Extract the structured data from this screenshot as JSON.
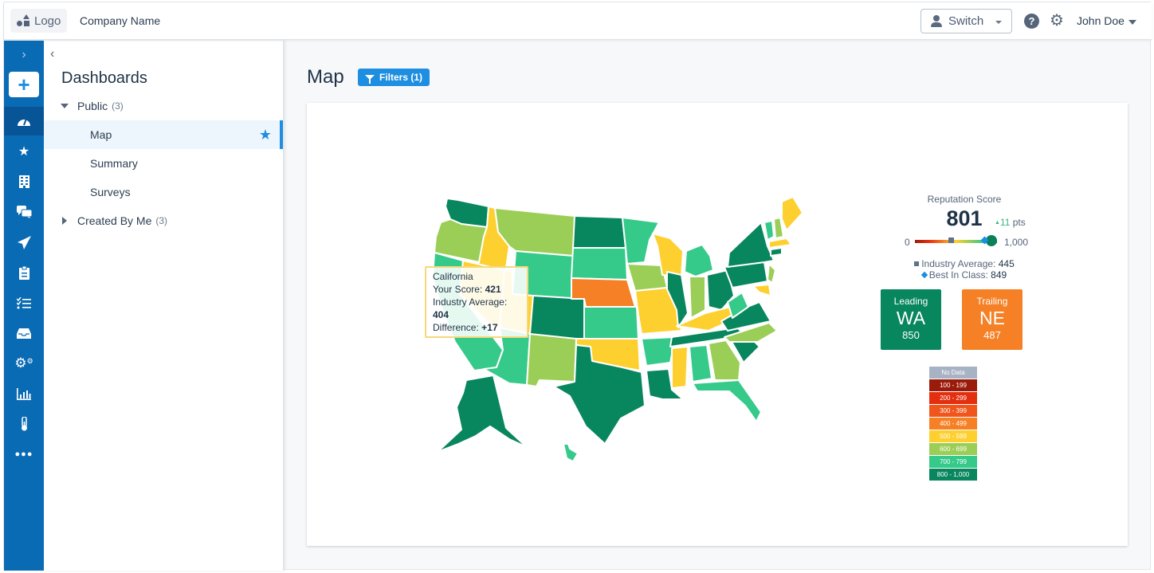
{
  "topbar": {
    "logo_label": "Logo",
    "company_name": "Company Name",
    "switch_label": "Switch",
    "help_icon": "question-circle-icon",
    "settings_icon": "gear-icon",
    "user_name": "John Doe"
  },
  "rail": {
    "items": [
      {
        "icon": "chevron-right-icon",
        "glyph": "›"
      },
      {
        "icon": "plus-icon",
        "glyph": "+"
      },
      {
        "icon": "dashboard-gauge-icon",
        "glyph": "◔",
        "active": true
      },
      {
        "icon": "star-icon",
        "glyph": "★"
      },
      {
        "icon": "building-icon",
        "glyph": "▦"
      },
      {
        "icon": "chat-bubbles-icon",
        "glyph": "💬"
      },
      {
        "icon": "paper-plane-icon",
        "glyph": "➤"
      },
      {
        "icon": "clipboard-icon",
        "glyph": "📋"
      },
      {
        "icon": "task-list-icon",
        "glyph": "☰"
      },
      {
        "icon": "inbox-icon",
        "glyph": "⌂"
      },
      {
        "icon": "cogs-icon",
        "glyph": "⚙"
      },
      {
        "icon": "bar-chart-icon",
        "glyph": "▥"
      },
      {
        "icon": "thermometer-icon",
        "glyph": "🌡"
      },
      {
        "icon": "more-icon",
        "glyph": "•••"
      }
    ]
  },
  "panel": {
    "title": "Dashboards",
    "groups": [
      {
        "label": "Public",
        "count": "(3)",
        "expanded": true,
        "items": [
          {
            "label": "Map",
            "selected": true,
            "starred": true
          },
          {
            "label": "Summary"
          },
          {
            "label": "Surveys"
          }
        ]
      },
      {
        "label": "Created By Me",
        "count": "(3)",
        "expanded": false
      }
    ]
  },
  "main": {
    "title": "Map",
    "filters_label": "Filters (1)"
  },
  "tooltip": {
    "state": "California",
    "score_label": "Your Score:",
    "score": "421",
    "industry_label": "Industry Average:",
    "industry": "404",
    "diff_label": "Difference:",
    "diff": "+17"
  },
  "score": {
    "label": "Reputation Score",
    "value": "801",
    "delta_arrow": "▲",
    "delta": "11",
    "delta_unit": "pts",
    "min": "0",
    "max": "1,000",
    "range": [
      0,
      1000
    ],
    "your_score": 801,
    "industry_average": 445,
    "best_in_class": 849,
    "industry_label": "Industry Average:",
    "industry_value": "445",
    "best_label": "Best In Class:",
    "best_value": "849"
  },
  "leading": {
    "label": "Leading",
    "state": "WA",
    "value": "850",
    "color": "#08865e"
  },
  "trailing": {
    "label": "Trailing",
    "state": "NE",
    "value": "487",
    "color": "#f58025"
  },
  "legend": [
    {
      "label": "No Data",
      "color": "#a7b3c4"
    },
    {
      "label": "100 - 199",
      "color": "#9b1b0a"
    },
    {
      "label": "200 - 299",
      "color": "#e42e10"
    },
    {
      "label": "300 - 399",
      "color": "#f0561c"
    },
    {
      "label": "400 - 499",
      "color": "#f58025"
    },
    {
      "label": "500 - 599",
      "color": "#fdd030"
    },
    {
      "label": "600 - 699",
      "color": "#9bce57"
    },
    {
      "label": "700 - 799",
      "color": "#35c98a"
    },
    {
      "label": "800 - 1,000",
      "color": "#08865e"
    }
  ],
  "map_states": [
    {
      "id": "WA",
      "bucket": "800 - 1,000"
    },
    {
      "id": "OR",
      "bucket": "600 - 699"
    },
    {
      "id": "CA",
      "bucket": "700 - 799"
    },
    {
      "id": "ID",
      "bucket": "500 - 599"
    },
    {
      "id": "NV",
      "bucket": "500 - 599"
    },
    {
      "id": "MT",
      "bucket": "600 - 699"
    },
    {
      "id": "WY",
      "bucket": "700 - 799"
    },
    {
      "id": "UT",
      "bucket": "500 - 599"
    },
    {
      "id": "AZ",
      "bucket": "700 - 799"
    },
    {
      "id": "CO",
      "bucket": "800 - 1,000"
    },
    {
      "id": "NM",
      "bucket": "600 - 699"
    },
    {
      "id": "ND",
      "bucket": "800 - 1,000"
    },
    {
      "id": "SD",
      "bucket": "700 - 799"
    },
    {
      "id": "NE",
      "bucket": "400 - 499"
    },
    {
      "id": "KS",
      "bucket": "700 - 799"
    },
    {
      "id": "OK",
      "bucket": "500 - 599"
    },
    {
      "id": "TX",
      "bucket": "800 - 1,000"
    },
    {
      "id": "MN",
      "bucket": "700 - 799"
    },
    {
      "id": "IA",
      "bucket": "600 - 699"
    },
    {
      "id": "MO",
      "bucket": "500 - 599"
    },
    {
      "id": "AR",
      "bucket": "700 - 799"
    },
    {
      "id": "LA",
      "bucket": "800 - 1,000"
    },
    {
      "id": "WI",
      "bucket": "500 - 599"
    },
    {
      "id": "IL",
      "bucket": "800 - 1,000"
    },
    {
      "id": "MI",
      "bucket": "700 - 799"
    },
    {
      "id": "IN",
      "bucket": "600 - 699"
    },
    {
      "id": "OH",
      "bucket": "800 - 1,000"
    },
    {
      "id": "KY",
      "bucket": "500 - 599"
    },
    {
      "id": "TN",
      "bucket": "800 - 1,000"
    },
    {
      "id": "MS",
      "bucket": "500 - 599"
    },
    {
      "id": "AL",
      "bucket": "700 - 799"
    },
    {
      "id": "GA",
      "bucket": "600 - 699"
    },
    {
      "id": "FL",
      "bucket": "700 - 799"
    },
    {
      "id": "SC",
      "bucket": "800 - 1,000"
    },
    {
      "id": "NC",
      "bucket": "600 - 699"
    },
    {
      "id": "VA",
      "bucket": "800 - 1,000"
    },
    {
      "id": "WV",
      "bucket": "700 - 799"
    },
    {
      "id": "PA",
      "bucket": "800 - 1,000"
    },
    {
      "id": "NY",
      "bucket": "800 - 1,000"
    },
    {
      "id": "NJ",
      "bucket": "600 - 699"
    },
    {
      "id": "MD",
      "bucket": "500 - 599"
    },
    {
      "id": "VT",
      "bucket": "700 - 799"
    },
    {
      "id": "NH",
      "bucket": "600 - 699"
    },
    {
      "id": "ME",
      "bucket": "500 - 599"
    },
    {
      "id": "MA",
      "bucket": "500 - 599"
    },
    {
      "id": "CT",
      "bucket": "800 - 1,000"
    },
    {
      "id": "AK",
      "bucket": "800 - 1,000"
    },
    {
      "id": "HI",
      "bucket": "700 - 799"
    }
  ]
}
